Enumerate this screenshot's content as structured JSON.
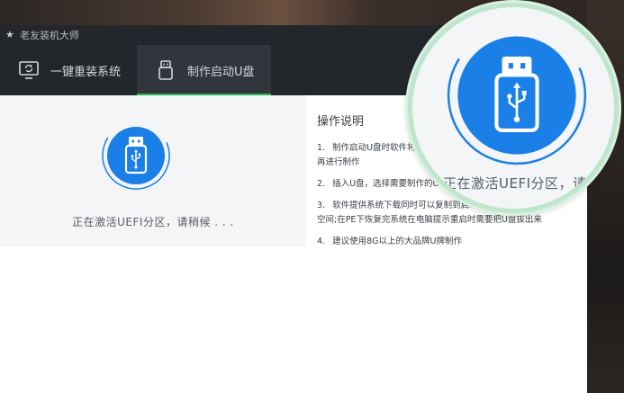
{
  "window": {
    "title": "老友装机大师",
    "close_glyph": "×"
  },
  "tabs": [
    {
      "label": "一键重装系统",
      "icon": "monitor-refresh-icon"
    },
    {
      "label": "制作启动U盘",
      "icon": "usb-drive-icon"
    }
  ],
  "status": {
    "text": "正在激活UEFI分区，请稍候 . . .",
    "magnified_text": "正在激活UEFI分区，请稍"
  },
  "instructions": {
    "title": "操作说明",
    "items": [
      {
        "num": "1.",
        "text": "制作启动U盘时软件将会",
        "cont": "再进行制作"
      },
      {
        "num": "2.",
        "text": "插入U盘，选择需要制作的U盘，"
      },
      {
        "num": "3.",
        "text": "软件提供系统下载同时可以复制到启动U盘，",
        "cont": "空间;在PE下恢复完系统在电脑提示重启时需要把U盘拔出来"
      },
      {
        "num": "4.",
        "text": "建议使用8G以上的大品牌U牌制作"
      }
    ]
  },
  "colors": {
    "accent_blue": "#1a7fe6",
    "accent_green": "#2fb45a",
    "titlebar": "#23272b"
  }
}
